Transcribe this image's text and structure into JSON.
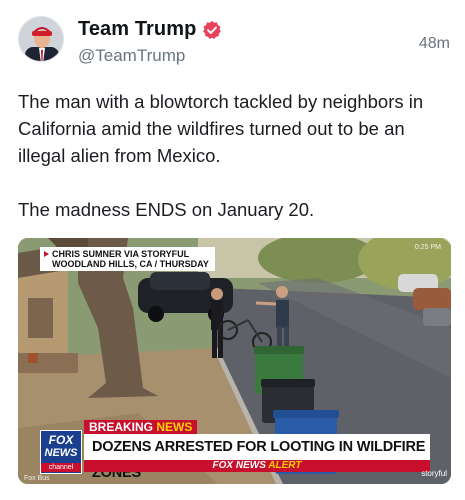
{
  "post": {
    "author_name": "Team Trump",
    "author_handle": "@TeamTrump",
    "time_ago": "48m",
    "text_line_1": "The man with a blowtorch tackled by neighbors in California amid the wildfires turned out to be an illegal alien from Mexico.",
    "text_line_2": "The madness ENDS on January 20."
  },
  "media": {
    "credit_line_1": "CHRIS SUMNER VIA STORYFUL",
    "credit_line_2": "WOODLAND HILLS, CA / THURSDAY",
    "timestamp": "0:25 PM",
    "breaking_word": "BREAKING",
    "breaking_news_word": "NEWS",
    "headline": "DOZENS ARRESTED FOR LOOTING IN WILDFIRE ZONES",
    "alert_prefix": "FOX NEWS",
    "alert_word": "ALERT",
    "logo_line_1": "FOX",
    "logo_line_2": "NEWS",
    "logo_line_3": "channel",
    "watermark": "storyful",
    "corner_text": "Fox Bus"
  },
  "colors": {
    "verified_badge": "#e8425a",
    "breaking_red": "#c8102e",
    "fox_blue": "#1a3f8f",
    "alert_yellow": "#ffd200"
  },
  "icons": {
    "verified": "verified-badge-icon"
  }
}
